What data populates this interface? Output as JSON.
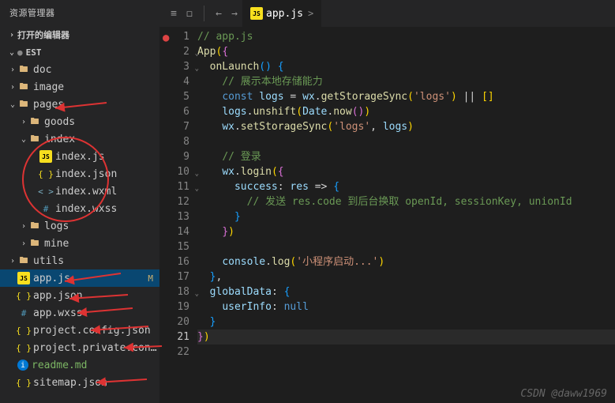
{
  "sidebar": {
    "title": "资源管理器",
    "section_open": "打开的编辑器",
    "project": "EST",
    "tree": [
      {
        "d": 0,
        "t": "f",
        "c": ">",
        "ic": "folder",
        "l": "doc"
      },
      {
        "d": 0,
        "t": "f",
        "c": ">",
        "ic": "folder",
        "l": "image"
      },
      {
        "d": 0,
        "t": "f",
        "c": "v",
        "ic": "folder",
        "l": "pages"
      },
      {
        "d": 1,
        "t": "f",
        "c": ">",
        "ic": "folder",
        "l": "goods"
      },
      {
        "d": 1,
        "t": "f",
        "c": "v",
        "ic": "folder",
        "l": "index"
      },
      {
        "d": 2,
        "t": "i",
        "ic": "js",
        "l": "index.js"
      },
      {
        "d": 2,
        "t": "i",
        "ic": "json",
        "l": "index.json"
      },
      {
        "d": 2,
        "t": "i",
        "ic": "wxml",
        "l": "index.wxml"
      },
      {
        "d": 2,
        "t": "i",
        "ic": "wxss",
        "l": "index.wxss"
      },
      {
        "d": 1,
        "t": "f",
        "c": ">",
        "ic": "folder",
        "l": "logs"
      },
      {
        "d": 1,
        "t": "f",
        "c": ">",
        "ic": "folder",
        "l": "mine"
      },
      {
        "d": 0,
        "t": "f",
        "c": ">",
        "ic": "folder",
        "l": "utils"
      },
      {
        "d": 0,
        "t": "i",
        "ic": "js",
        "l": "app.js",
        "active": true,
        "mod": "M"
      },
      {
        "d": 0,
        "t": "i",
        "ic": "json",
        "l": "app.json"
      },
      {
        "d": 0,
        "t": "i",
        "ic": "wxss",
        "l": "app.wxss"
      },
      {
        "d": 0,
        "t": "i",
        "ic": "json",
        "l": "project.config.json"
      },
      {
        "d": 0,
        "t": "i",
        "ic": "json",
        "l": "project.private.config.js..."
      },
      {
        "d": 0,
        "t": "i",
        "ic": "info",
        "l": "readme.md",
        "green": true
      },
      {
        "d": 0,
        "t": "i",
        "ic": "json",
        "l": "sitemap.json"
      }
    ]
  },
  "editor": {
    "tab_icon": "js",
    "tab_label": "app.js",
    "breadcrumb": ">",
    "lines": [
      [
        [
          "c-com",
          "// app.js"
        ]
      ],
      [
        [
          "c-fn",
          "App"
        ],
        [
          "c-b1",
          "("
        ],
        [
          "c-b2",
          "{"
        ]
      ],
      [
        [
          "",
          "  "
        ],
        [
          "c-fn",
          "onLaunch"
        ],
        [
          "c-b3",
          "("
        ],
        [
          "c-b3",
          ")"
        ],
        [
          "",
          " "
        ],
        [
          "c-b3",
          "{"
        ]
      ],
      [
        [
          "",
          "    "
        ],
        [
          "c-com",
          "// 展示本地存储能力"
        ]
      ],
      [
        [
          "",
          "    "
        ],
        [
          "c-kw",
          "const"
        ],
        [
          "",
          " "
        ],
        [
          "c-var",
          "logs"
        ],
        [
          "c-op",
          " = "
        ],
        [
          "c-var",
          "wx"
        ],
        [
          "c-p",
          "."
        ],
        [
          "c-fn",
          "getStorageSync"
        ],
        [
          "c-b1",
          "("
        ],
        [
          "c-str",
          "'logs'"
        ],
        [
          "c-b1",
          ")"
        ],
        [
          "c-op",
          " || "
        ],
        [
          "c-b1",
          "["
        ],
        [
          "c-b1",
          "]"
        ]
      ],
      [
        [
          "",
          "    "
        ],
        [
          "c-var",
          "logs"
        ],
        [
          "c-p",
          "."
        ],
        [
          "c-fn",
          "unshift"
        ],
        [
          "c-b1",
          "("
        ],
        [
          "c-var",
          "Date"
        ],
        [
          "c-p",
          "."
        ],
        [
          "c-fn",
          "now"
        ],
        [
          "c-b2",
          "("
        ],
        [
          "c-b2",
          ")"
        ],
        [
          "c-b1",
          ")"
        ]
      ],
      [
        [
          "",
          "    "
        ],
        [
          "c-var",
          "wx"
        ],
        [
          "c-p",
          "."
        ],
        [
          "c-fn",
          "setStorageSync"
        ],
        [
          "c-b1",
          "("
        ],
        [
          "c-str",
          "'logs'"
        ],
        [
          "c-p",
          ", "
        ],
        [
          "c-var",
          "logs"
        ],
        [
          "c-b1",
          ")"
        ]
      ],
      [],
      [
        [
          "",
          "    "
        ],
        [
          "c-com",
          "// 登录"
        ]
      ],
      [
        [
          "",
          "    "
        ],
        [
          "c-var",
          "wx"
        ],
        [
          "c-p",
          "."
        ],
        [
          "c-fn",
          "login"
        ],
        [
          "c-b1",
          "("
        ],
        [
          "c-b2",
          "{"
        ]
      ],
      [
        [
          "",
          "      "
        ],
        [
          "c-prop",
          "success"
        ],
        [
          "c-p",
          ": "
        ],
        [
          "c-var",
          "res"
        ],
        [
          "c-op",
          " => "
        ],
        [
          "c-b3",
          "{"
        ]
      ],
      [
        [
          "",
          "        "
        ],
        [
          "c-com",
          "// 发送 res.code 到后台换取 openId, sessionKey, unionId"
        ]
      ],
      [
        [
          "",
          "      "
        ],
        [
          "c-b3",
          "}"
        ]
      ],
      [
        [
          "",
          "    "
        ],
        [
          "c-b2",
          "}"
        ],
        [
          "c-b1",
          ")"
        ]
      ],
      [],
      [
        [
          "",
          "    "
        ],
        [
          "c-var",
          "console"
        ],
        [
          "c-p",
          "."
        ],
        [
          "c-fn",
          "log"
        ],
        [
          "c-b1",
          "("
        ],
        [
          "c-str",
          "'小程序启动...'"
        ],
        [
          "c-b1",
          ")"
        ]
      ],
      [
        [
          "",
          "  "
        ],
        [
          "c-b3",
          "}"
        ],
        [
          "c-p",
          ","
        ]
      ],
      [
        [
          "",
          "  "
        ],
        [
          "c-prop",
          "globalData"
        ],
        [
          "c-p",
          ": "
        ],
        [
          "c-b3",
          "{"
        ]
      ],
      [
        [
          "",
          "    "
        ],
        [
          "c-prop",
          "userInfo"
        ],
        [
          "c-p",
          ": "
        ],
        [
          "c-kw",
          "null"
        ]
      ],
      [
        [
          "",
          "  "
        ],
        [
          "c-b3",
          "}"
        ]
      ],
      [
        [
          "c-b2",
          "}"
        ],
        [
          "c-b1",
          ")"
        ]
      ],
      []
    ],
    "folds": [
      2,
      3,
      10,
      11,
      18
    ],
    "cur": 21
  },
  "watermark": "CSDN @daww1969"
}
